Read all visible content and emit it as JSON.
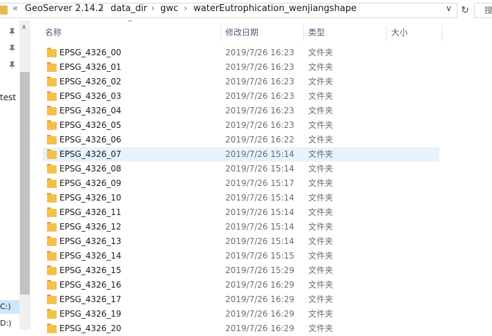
{
  "address": {
    "overflow": "«",
    "crumbs": [
      "GeoServer 2.14.2",
      "data_dir",
      "gwc",
      "waterEutrophication_wenjiangshape"
    ],
    "separator": "›",
    "dropdown": "∨",
    "refresh": "↻"
  },
  "search": {
    "placeholder": "搜"
  },
  "nav": {
    "up_arrow": "∧",
    "items": [
      "test"
    ],
    "drives": [
      "C:)",
      "D:)"
    ]
  },
  "columns": {
    "name": "名称",
    "modified": "修改日期",
    "type": "类型",
    "size": "大小",
    "sort_indicator": "^"
  },
  "files": [
    {
      "name": "EPSG_4326_00",
      "modified": "2019/7/26 16:23",
      "type": "文件夹",
      "selected": false
    },
    {
      "name": "EPSG_4326_01",
      "modified": "2019/7/26 16:23",
      "type": "文件夹",
      "selected": false
    },
    {
      "name": "EPSG_4326_02",
      "modified": "2019/7/26 16:23",
      "type": "文件夹",
      "selected": false
    },
    {
      "name": "EPSG_4326_03",
      "modified": "2019/7/26 16:23",
      "type": "文件夹",
      "selected": false
    },
    {
      "name": "EPSG_4326_04",
      "modified": "2019/7/26 16:23",
      "type": "文件夹",
      "selected": false
    },
    {
      "name": "EPSG_4326_05",
      "modified": "2019/7/26 16:23",
      "type": "文件夹",
      "selected": false
    },
    {
      "name": "EPSG_4326_06",
      "modified": "2019/7/26 16:22",
      "type": "文件夹",
      "selected": false
    },
    {
      "name": "EPSG_4326_07",
      "modified": "2019/7/26 15:14",
      "type": "文件夹",
      "selected": true
    },
    {
      "name": "EPSG_4326_08",
      "modified": "2019/7/26 15:14",
      "type": "文件夹",
      "selected": false
    },
    {
      "name": "EPSG_4326_09",
      "modified": "2019/7/26 15:17",
      "type": "文件夹",
      "selected": false
    },
    {
      "name": "EPSG_4326_10",
      "modified": "2019/7/26 15:14",
      "type": "文件夹",
      "selected": false
    },
    {
      "name": "EPSG_4326_11",
      "modified": "2019/7/26 15:14",
      "type": "文件夹",
      "selected": false
    },
    {
      "name": "EPSG_4326_12",
      "modified": "2019/7/26 15:14",
      "type": "文件夹",
      "selected": false
    },
    {
      "name": "EPSG_4326_13",
      "modified": "2019/7/26 15:14",
      "type": "文件夹",
      "selected": false
    },
    {
      "name": "EPSG_4326_14",
      "modified": "2019/7/26 15:15",
      "type": "文件夹",
      "selected": false
    },
    {
      "name": "EPSG_4326_15",
      "modified": "2019/7/26 15:29",
      "type": "文件夹",
      "selected": false
    },
    {
      "name": "EPSG_4326_16",
      "modified": "2019/7/26 16:29",
      "type": "文件夹",
      "selected": false
    },
    {
      "name": "EPSG_4326_17",
      "modified": "2019/7/26 16:29",
      "type": "文件夹",
      "selected": false
    },
    {
      "name": "EPSG_4326_19",
      "modified": "2019/7/26 16:29",
      "type": "文件夹",
      "selected": false
    },
    {
      "name": "EPSG_4326_20",
      "modified": "2019/7/26 16:29",
      "type": "文件夹",
      "selected": false
    }
  ]
}
